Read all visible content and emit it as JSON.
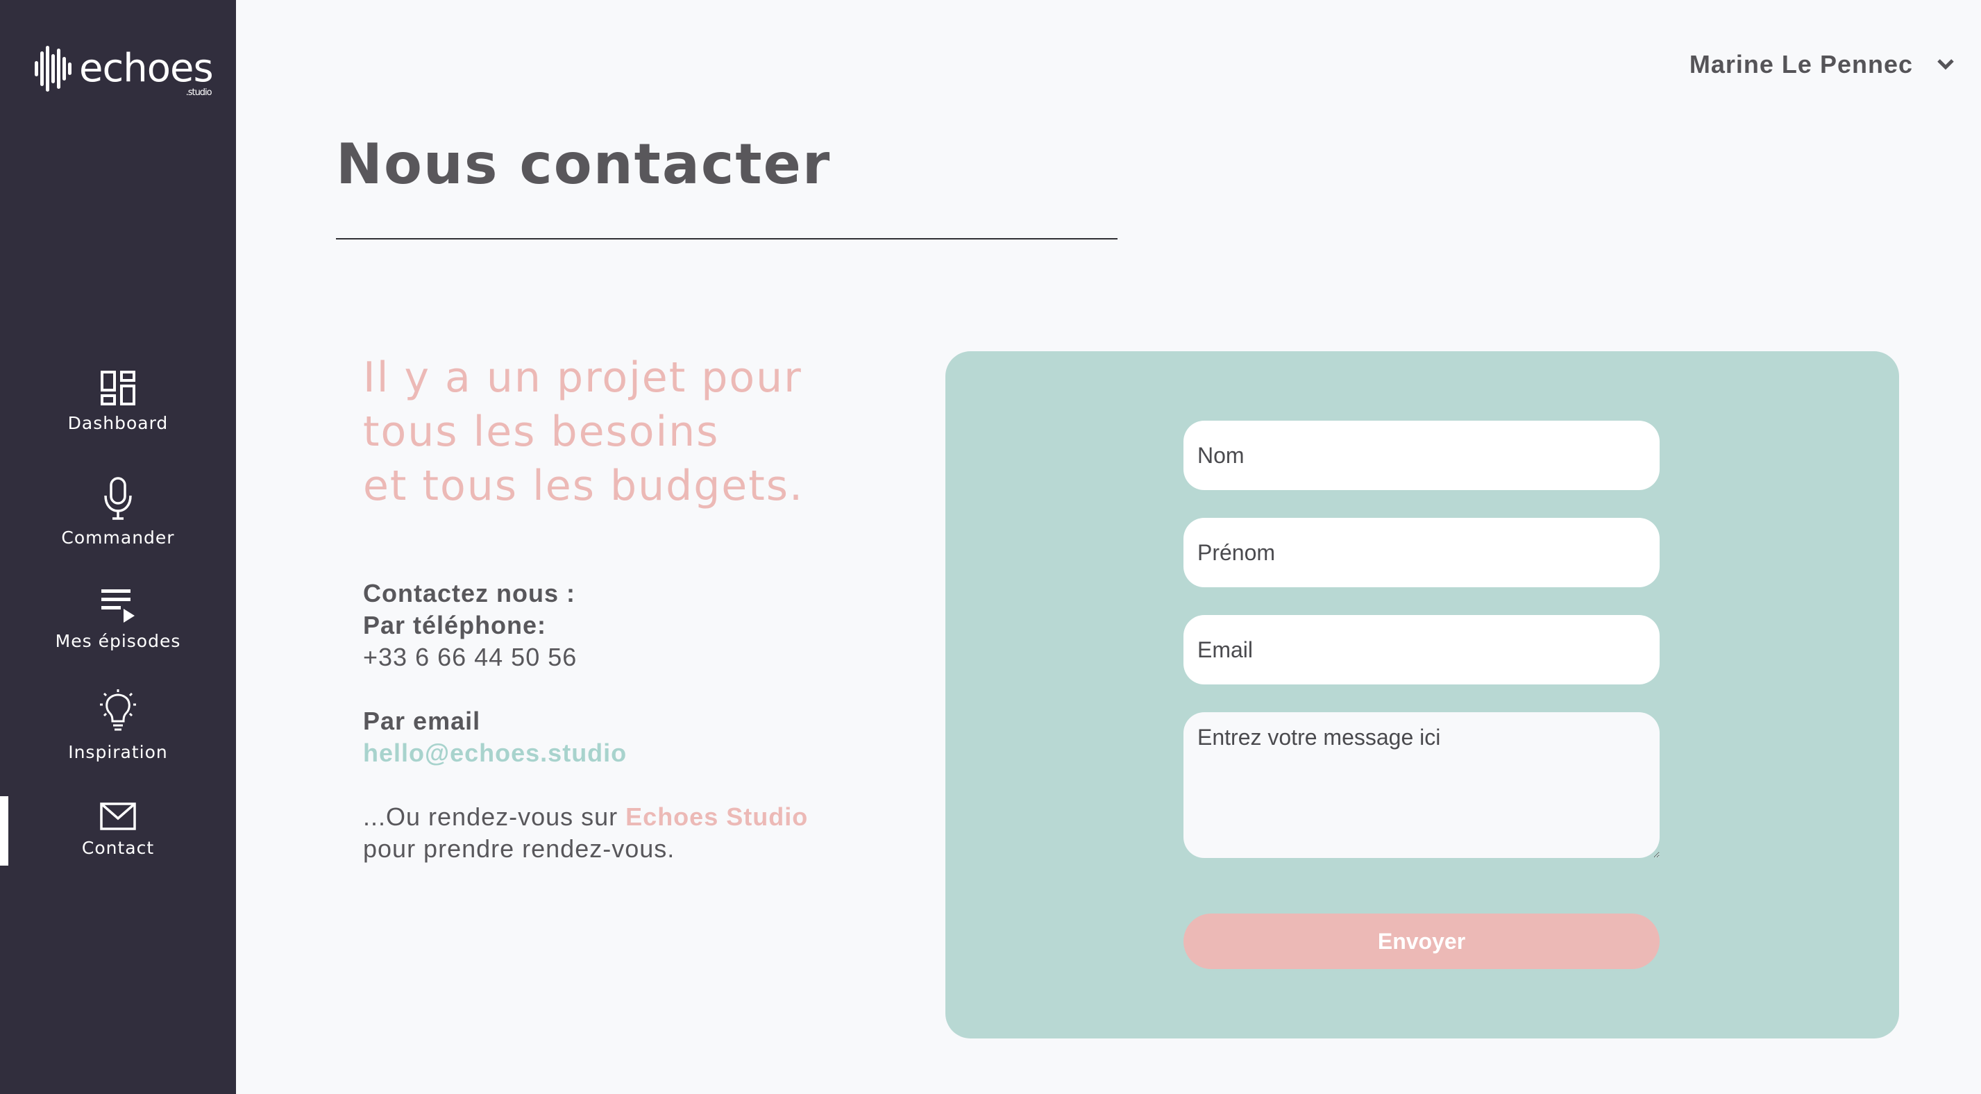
{
  "brand": {
    "name": "echoes",
    "sub": ".studio"
  },
  "user": {
    "name": "Marine Le Pennec"
  },
  "nav": {
    "items": [
      {
        "label": "Dashboard",
        "icon": "dashboard-icon"
      },
      {
        "label": "Commander",
        "icon": "microphone-icon"
      },
      {
        "label": "Mes épisodes",
        "icon": "playlist-icon"
      },
      {
        "label": "Inspiration",
        "icon": "lightbulb-icon"
      },
      {
        "label": "Contact",
        "icon": "mail-icon",
        "active": true
      }
    ]
  },
  "page": {
    "title": "Nous contacter"
  },
  "tagline": {
    "line1": "Il y a un projet pour",
    "line2": "tous les besoins",
    "line3": "et tous les budgets."
  },
  "contact": {
    "heading": "Contactez nous :",
    "phone_label": "Par téléphone:",
    "phone": "+33 6 66 44 50 56",
    "email_label": "Par email",
    "email": "hello@echoes.studio",
    "visit_prefix": "...Ou rendez-vous sur ",
    "visit_link": "Echoes Studio",
    "visit_suffix": "pour prendre rendez-vous."
  },
  "form": {
    "nom_placeholder": "Nom",
    "prenom_placeholder": "Prénom",
    "email_placeholder": "Email",
    "message_placeholder": "Entrez votre message ici",
    "submit_label": "Envoyer"
  },
  "colors": {
    "sidebar": "#312e3d",
    "accent_pink": "#ecb9b6",
    "accent_teal": "#b8d8d3",
    "link_teal": "#a8d3cd"
  }
}
